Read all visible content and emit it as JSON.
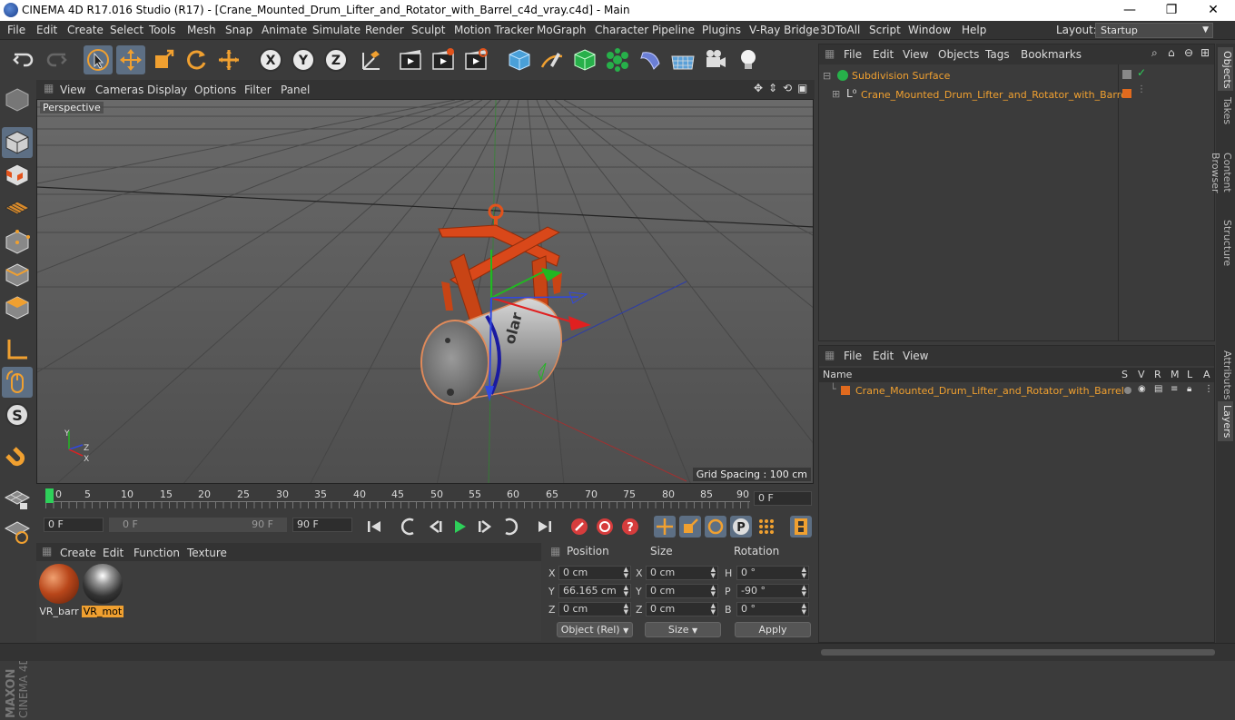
{
  "window": {
    "title": "CINEMA 4D R17.016 Studio (R17) - [Crane_Mounted_Drum_Lifter_and_Rotator_with_Barrel_c4d_vray.c4d] - Main",
    "minimize": "—",
    "maximize": "❐",
    "close": "✕"
  },
  "menubar": {
    "items": [
      "File",
      "Edit",
      "Create",
      "Select",
      "Tools",
      "Mesh",
      "Snap",
      "Animate",
      "Simulate",
      "Render",
      "Sculpt",
      "Motion Tracker",
      "MoGraph",
      "Character",
      "Pipeline",
      "Plugins",
      "V-Ray Bridge",
      "3DToAll",
      "Script",
      "Window",
      "Help"
    ],
    "layout_label": "Layout:",
    "layout_value": "Startup"
  },
  "viewport": {
    "menu": [
      "View",
      "Cameras",
      "Display",
      "Options",
      "Filter",
      "Panel"
    ],
    "camera_label": "Perspective",
    "grid_spacing": "Grid Spacing : 100 cm",
    "axis_labels": {
      "y": "Y",
      "x": "X",
      "z": "Z"
    },
    "barrel_text": "olar"
  },
  "timeline": {
    "ticks": [
      "0",
      "5",
      "10",
      "15",
      "20",
      "25",
      "30",
      "35",
      "40",
      "45",
      "50",
      "55",
      "60",
      "65",
      "70",
      "75",
      "80",
      "85",
      "90"
    ],
    "current_frame": "0 F"
  },
  "transport": {
    "start": "0 F",
    "range_start": "0 F",
    "range_end": "90 F",
    "end": "90 F"
  },
  "materials": {
    "menu": [
      "Create",
      "Edit",
      "Function",
      "Texture"
    ],
    "items": [
      {
        "name": "VR_barr",
        "selected": false
      },
      {
        "name": "VR_mot",
        "selected": true
      }
    ]
  },
  "coordinates": {
    "headers": {
      "position": "Position",
      "size": "Size",
      "rotation": "Rotation"
    },
    "rows": [
      {
        "axis": "X",
        "pos": "0 cm",
        "size_axis": "X",
        "size": "0 cm",
        "rot_axis": "H",
        "rot": "0 °"
      },
      {
        "axis": "Y",
        "pos": "66.165 cm",
        "size_axis": "Y",
        "size": "0 cm",
        "rot_axis": "P",
        "rot": "-90 °"
      },
      {
        "axis": "Z",
        "pos": "0 cm",
        "size_axis": "Z",
        "size": "0 cm",
        "rot_axis": "B",
        "rot": "0 °"
      }
    ],
    "mode": "Object (Rel)",
    "size_mode": "Size",
    "apply": "Apply"
  },
  "objects": {
    "menu": [
      "File",
      "Edit",
      "View",
      "Objects",
      "Tags",
      "Bookmarks"
    ],
    "items": [
      {
        "name": "Subdivision Surface",
        "color": "#f0a030"
      },
      {
        "name": "Crane_Mounted_Drum_Lifter_and_Rotator_with_Barrel",
        "color": "#f0a030"
      }
    ]
  },
  "layers": {
    "menu": [
      "File",
      "Edit",
      "View"
    ],
    "columns": {
      "name": "Name",
      "s": "S",
      "v": "V",
      "r": "R",
      "m": "M",
      "l": "L",
      "a": "A"
    },
    "items": [
      {
        "name": "Crane_Mounted_Drum_Lifter_and_Rotator_with_Barrel",
        "color": "#e06a1e"
      }
    ]
  },
  "side_tabs": [
    "Objects",
    "Takes",
    "Content Browser",
    "Structure",
    "Attributes",
    "Layers"
  ],
  "colors": {
    "accent": "#f0a030",
    "lifter": "#e2531c",
    "active_tool": "#5d6f84"
  }
}
